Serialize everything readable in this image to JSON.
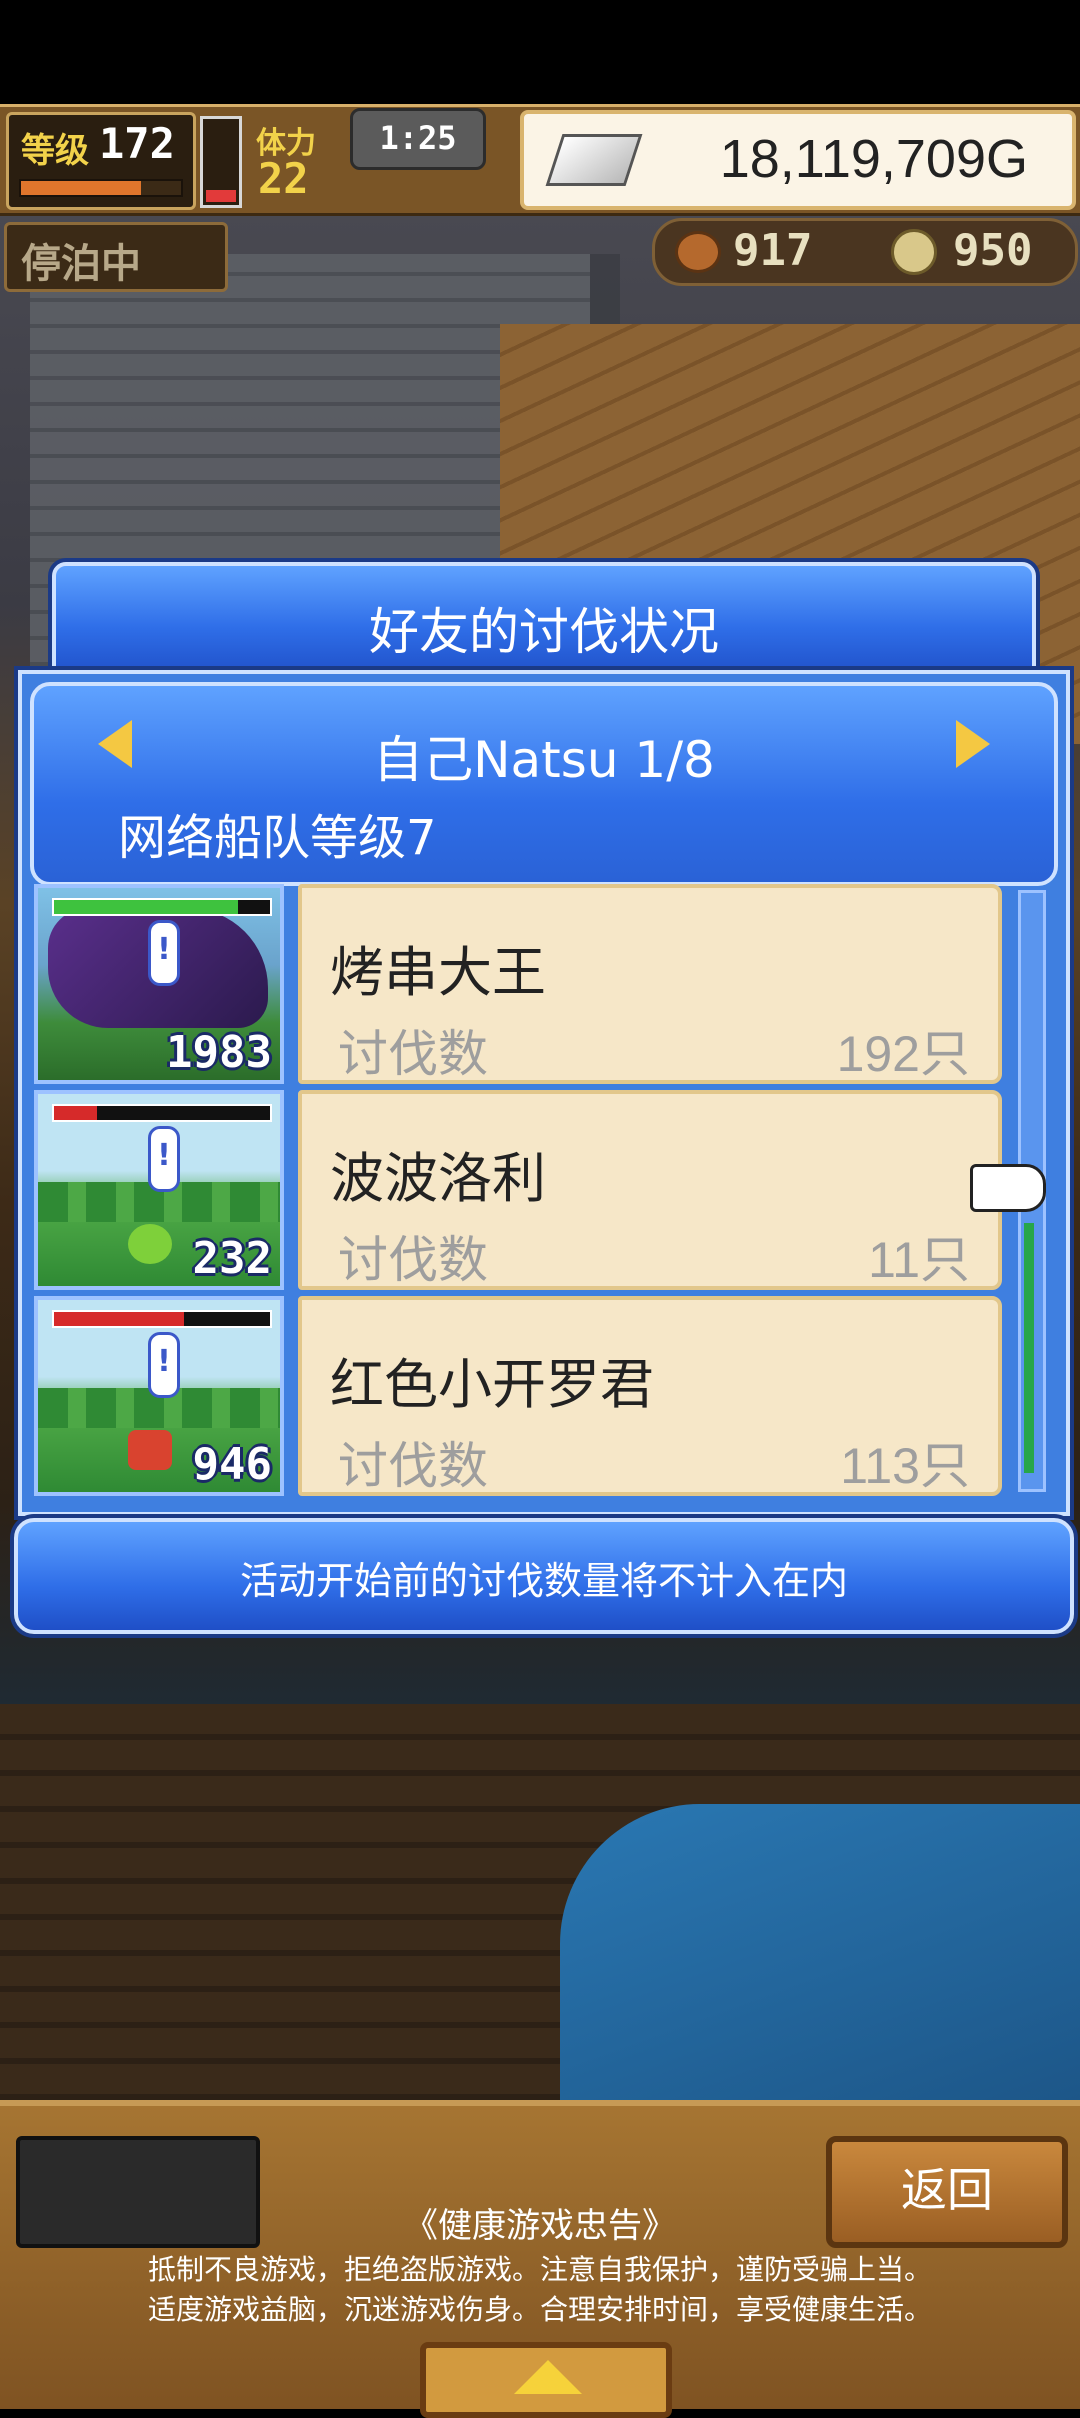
{
  "hud": {
    "level_label": "等级",
    "level": "172",
    "level_progress": 0.75,
    "hp_fraction": 0.15,
    "stamina_label": "体力",
    "stamina": "22",
    "timer": "1:25",
    "gold": "18,119,709G",
    "docked_label": "停泊中",
    "meat": "917",
    "coins": "950"
  },
  "dialog": {
    "title": "好友的讨伐状况",
    "player": "自己Natsu 1/8",
    "fleet_level": "网络船队等级7",
    "kill_label": "讨伐数",
    "entries": [
      {
        "name": "烤串大王",
        "count_badge": "1983",
        "kills": "192只",
        "hp_fraction": 0.85
      },
      {
        "name": "波波洛利",
        "count_badge": "232",
        "kills": "11只",
        "hp_fraction": 0.2
      },
      {
        "name": "红色小开罗君",
        "count_badge": "946",
        "kills": "113只",
        "hp_fraction": 0.6
      }
    ],
    "notice": "活动开始前的讨伐数量将不计入在内"
  },
  "footer": {
    "back_label": "返回",
    "advisory_title": "《健康游戏忠告》",
    "advisory_line1": "抵制不良游戏，拒绝盗版游戏。注意自我保护，谨防受骗上当。",
    "advisory_line2": "适度游戏益脑，沉迷游戏伤身。合理安排时间，享受健康生活。"
  }
}
